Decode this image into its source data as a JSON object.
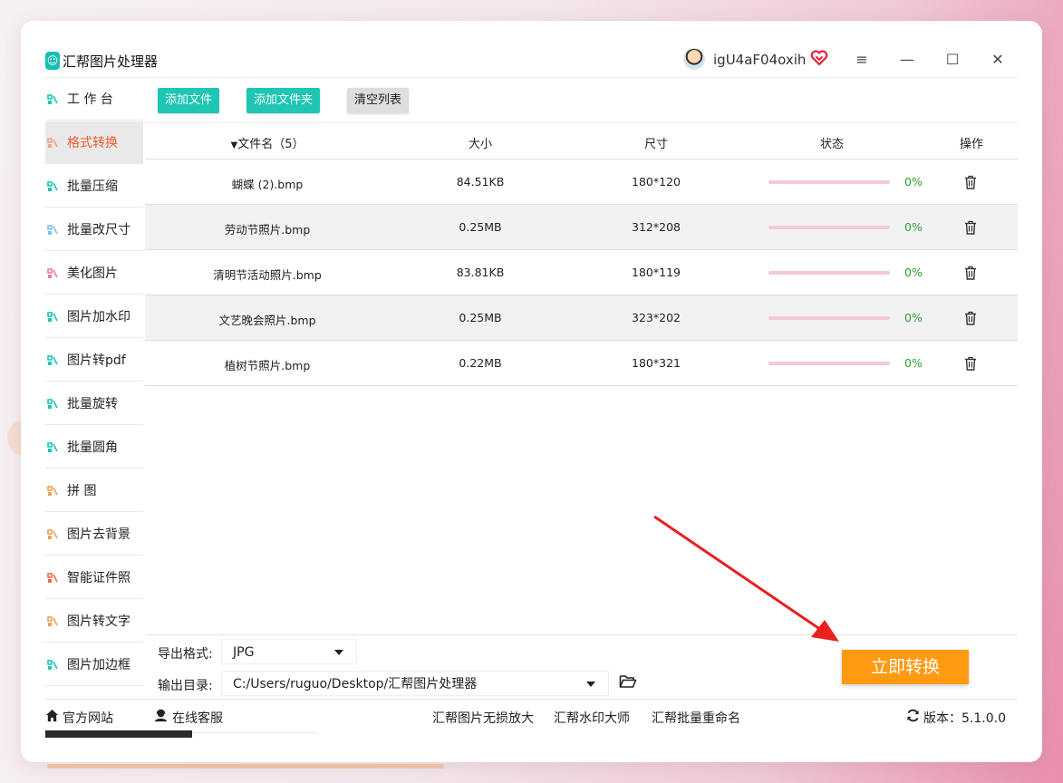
{
  "app": {
    "title": "汇帮图片处理器",
    "username": "igU4aF04oxih",
    "icons": {
      "logo": "app-logo-icon",
      "vip": "vip-heart-icon",
      "menu": "hamburger-icon",
      "minimize": "minimize-icon",
      "maximize": "maximize-icon",
      "close": "close-icon"
    },
    "controls": {
      "menu": "≡",
      "minimize": "—",
      "maximize": "☐",
      "close": "✕"
    }
  },
  "sidebar": {
    "items": [
      {
        "label": "工 作 台",
        "icon": "grid-icon",
        "active": false
      },
      {
        "label": "格式转换",
        "icon": "convert-icon",
        "active": true
      },
      {
        "label": "批量压缩",
        "icon": "compress-icon",
        "active": false
      },
      {
        "label": "批量改尺寸",
        "icon": "resize-icon",
        "active": false
      },
      {
        "label": "美化图片",
        "icon": "beautify-icon",
        "active": false
      },
      {
        "label": "图片加水印",
        "icon": "watermark-icon",
        "active": false
      },
      {
        "label": "图片转pdf",
        "icon": "pdf-icon",
        "active": false
      },
      {
        "label": "批量旋转",
        "icon": "rotate-icon",
        "active": false
      },
      {
        "label": "批量圆角",
        "icon": "round-corner-icon",
        "active": false
      },
      {
        "label": "拼    图",
        "icon": "collage-icon",
        "active": false
      },
      {
        "label": "图片去背景",
        "icon": "remove-bg-icon",
        "active": false
      },
      {
        "label": "智能证件照",
        "icon": "id-photo-icon",
        "active": false
      },
      {
        "label": "图片转文字",
        "icon": "ocr-icon",
        "active": false
      },
      {
        "label": "图片加边框",
        "icon": "frame-icon",
        "active": false
      }
    ]
  },
  "toolbar": {
    "add_file": "添加文件",
    "add_folder": "添加文件夹",
    "clear_list": "清空列表"
  },
  "table": {
    "headers": {
      "filename": "文件名（5）",
      "size": "大小",
      "dimensions": "尺寸",
      "status": "状态",
      "action": "操作"
    },
    "rows": [
      {
        "filename": "蝴蝶 (2).bmp",
        "size": "84.51KB",
        "dimensions": "180*120",
        "progress": 0,
        "percent": "0%"
      },
      {
        "filename": "劳动节照片.bmp",
        "size": "0.25MB",
        "dimensions": "312*208",
        "progress": 0,
        "percent": "0%"
      },
      {
        "filename": "清明节活动照片.bmp",
        "size": "83.81KB",
        "dimensions": "180*119",
        "progress": 0,
        "percent": "0%"
      },
      {
        "filename": "文艺晚会照片.bmp",
        "size": "0.25MB",
        "dimensions": "323*202",
        "progress": 0,
        "percent": "0%"
      },
      {
        "filename": "植树节照片.bmp",
        "size": "0.22MB",
        "dimensions": "180*321",
        "progress": 0,
        "percent": "0%"
      }
    ]
  },
  "output": {
    "format_label": "导出格式:",
    "format_value": "JPG",
    "dir_label": "输出目录:",
    "dir_value": "C:/Users/ruguo/Desktop/汇帮图片处理器"
  },
  "convert_button": "立即转换",
  "footer": {
    "website": "官方网站",
    "support": "在线客服",
    "link1": "汇帮图片无损放大",
    "link2": "汇帮水印大师",
    "link3": "汇帮批量重命名",
    "version": "版本：5.1.0.0"
  },
  "colors": {
    "accent": "#1ec6b3",
    "active_text": "#ee5a2e",
    "convert": "#ff9a12",
    "percent_text": "#2aa02a",
    "progress_track": "#f4c9d4",
    "arrow": "#e8201e"
  }
}
